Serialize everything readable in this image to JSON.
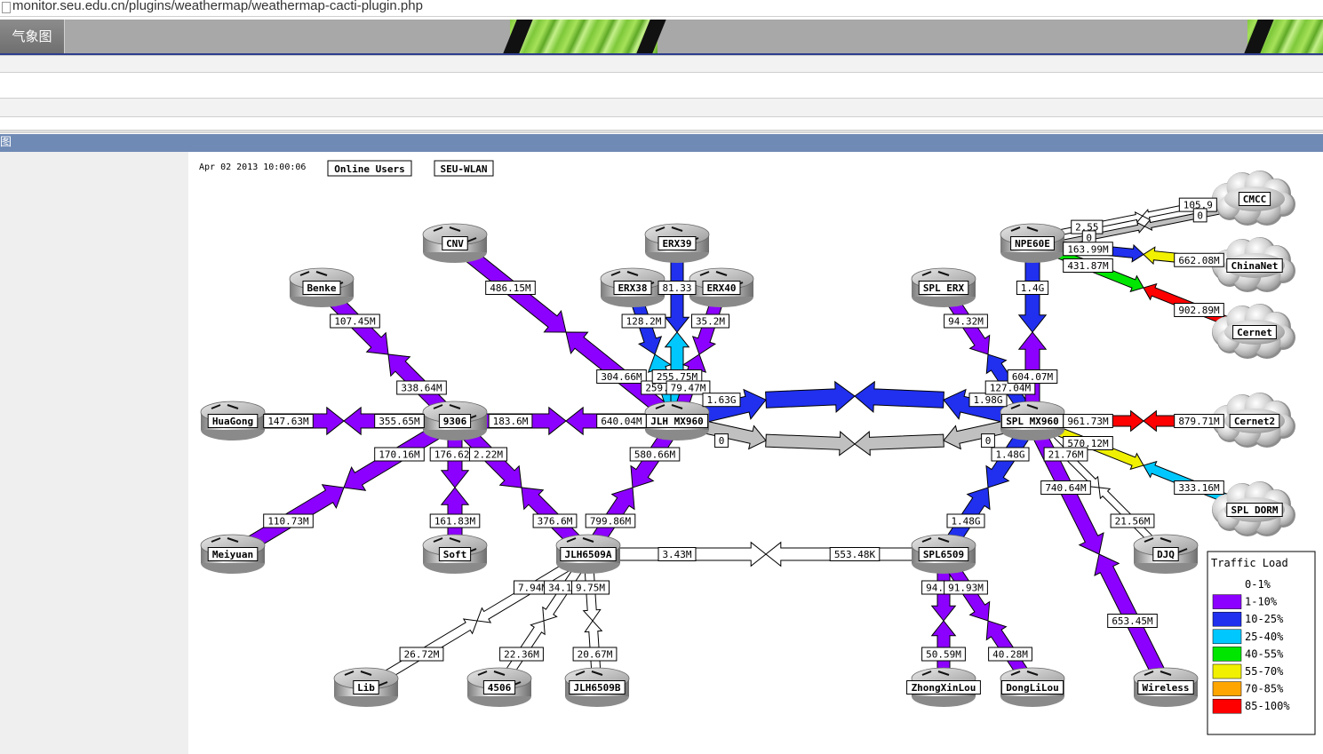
{
  "browser": {
    "url": "monitor.seu.edu.cn/plugins/weathermap/weathermap-cacti-plugin.php"
  },
  "header": {
    "tab_label": "气象图"
  },
  "section": {
    "label": "图"
  },
  "map": {
    "timestamp": "Apr 02 2013 10:00:06",
    "buttons": [
      "Online Users",
      "SEU-WLAN"
    ],
    "colors": {
      "gray": "#c0c0c0",
      "white": "#ffffff",
      "purple": "#8c00ff",
      "blue": "#2030ee",
      "cyan": "#00c8ff",
      "green": "#00e600",
      "yellow": "#f0f000",
      "orange": "#ffa500",
      "red": "#ff0000"
    },
    "nodes": [
      {
        "id": "cnv",
        "label": "CNV",
        "type": "router"
      },
      {
        "id": "erx39",
        "label": "ERX39",
        "type": "router"
      },
      {
        "id": "erx38",
        "label": "ERX38",
        "type": "router"
      },
      {
        "id": "erx40",
        "label": "ERX40",
        "type": "router"
      },
      {
        "id": "benke",
        "label": "Benke",
        "type": "router"
      },
      {
        "id": "huagong",
        "label": "HuaGong",
        "type": "router"
      },
      {
        "id": "n9306",
        "label": "9306",
        "type": "router"
      },
      {
        "id": "jlhmx",
        "label": "JLH MX960",
        "type": "router"
      },
      {
        "id": "meiyuan",
        "label": "Meiyuan",
        "type": "router"
      },
      {
        "id": "soft",
        "label": "Soft",
        "type": "router"
      },
      {
        "id": "jlh6509a",
        "label": "JLH6509A",
        "type": "router"
      },
      {
        "id": "lib",
        "label": "Lib",
        "type": "router"
      },
      {
        "id": "n4506",
        "label": "4506",
        "type": "router"
      },
      {
        "id": "jlh6509b",
        "label": "JLH6509B",
        "type": "router"
      },
      {
        "id": "splerx",
        "label": "SPL ERX",
        "type": "router"
      },
      {
        "id": "npe60e",
        "label": "NPE60E",
        "type": "router"
      },
      {
        "id": "splmx",
        "label": "SPL MX960",
        "type": "router"
      },
      {
        "id": "spl6509",
        "label": "SPL6509",
        "type": "router"
      },
      {
        "id": "zhongxinlou",
        "label": "ZhongXinLou",
        "type": "router"
      },
      {
        "id": "donglilou",
        "label": "DongLiLou",
        "type": "router"
      },
      {
        "id": "djq",
        "label": "DJQ",
        "type": "router"
      },
      {
        "id": "wireless",
        "label": "Wireless",
        "type": "router"
      },
      {
        "id": "cmcc",
        "label": "CMCC",
        "type": "cloud"
      },
      {
        "id": "chinanet",
        "label": "ChinaNet",
        "type": "cloud"
      },
      {
        "id": "cernet",
        "label": "Cernet",
        "type": "cloud"
      },
      {
        "id": "cernet2",
        "label": "Cernet2",
        "type": "cloud"
      },
      {
        "id": "spldorm",
        "label": "SPL DORM",
        "type": "cloud"
      }
    ],
    "links": [
      {
        "from": "benke",
        "to": "n9306",
        "w": 16,
        "a": {
          "label": "107.45M",
          "color": "purple"
        },
        "b": {
          "label": "338.64M",
          "color": "purple"
        }
      },
      {
        "from": "cnv",
        "to": "jlhmx",
        "w": 16,
        "a": {
          "label": "486.15M",
          "color": "purple"
        },
        "b": {
          "label": "304.66M",
          "color": "purple"
        }
      },
      {
        "from": "erx38",
        "to": "jlhmx",
        "w": 14,
        "a": {
          "label": "128.2M",
          "color": "blue"
        },
        "b": {
          "label": "259.44M",
          "color": "cyan"
        }
      },
      {
        "from": "erx39",
        "to": "jlhmx",
        "w": 14,
        "a": {
          "label": "81.33",
          "color": "blue"
        },
        "b": {
          "label": "255.75M",
          "color": "cyan"
        }
      },
      {
        "from": "erx40",
        "to": "jlhmx",
        "w": 14,
        "a": {
          "label": "35.2M",
          "color": "purple"
        },
        "b": {
          "label": "79.47M",
          "color": "purple"
        }
      },
      {
        "from": "huagong",
        "to": "n9306",
        "w": 16,
        "a": {
          "label": "147.63M",
          "color": "purple"
        },
        "b": {
          "label": "355.65M",
          "color": "purple"
        }
      },
      {
        "from": "n9306",
        "to": "jlhmx",
        "w": 16,
        "a": {
          "label": "183.6M",
          "color": "purple"
        },
        "b": {
          "label": "640.04M",
          "color": "purple"
        }
      },
      {
        "from": "n9306",
        "to": "meiyuan",
        "w": 16,
        "a": {
          "label": "170.16M",
          "color": "purple"
        },
        "b": {
          "label": "110.73M",
          "color": "purple"
        }
      },
      {
        "from": "n9306",
        "to": "soft",
        "w": 16,
        "a": {
          "label": "176.62M",
          "color": "purple"
        },
        "b": {
          "label": "161.83M",
          "color": "purple"
        }
      },
      {
        "from": "n9306",
        "to": "jlh6509a",
        "w": 16,
        "a": {
          "label": "2.22M",
          "color": "purple"
        },
        "b": {
          "label": "376.6M",
          "color": "purple"
        }
      },
      {
        "from": "jlhmx",
        "to": "jlh6509a",
        "w": 16,
        "a": {
          "label": "580.66M",
          "color": "purple"
        },
        "b": {
          "label": "799.86M",
          "color": "purple"
        }
      },
      {
        "from": "jlhmx",
        "to": "splmx",
        "w": 18,
        "a": {
          "label": "1.63G",
          "color": "blue"
        },
        "b": {
          "label": "1.98G",
          "color": "blue"
        },
        "curve": -28
      },
      {
        "from": "jlhmx",
        "to": "splmx",
        "w": 14,
        "a": {
          "label": "0",
          "color": "gray"
        },
        "b": {
          "label": "0",
          "color": "gray"
        },
        "curve": 26
      },
      {
        "from": "jlh6509a",
        "to": "spl6509",
        "w": 14,
        "a": {
          "label": "3.43M",
          "color": "white"
        },
        "b": {
          "label": "553.48K",
          "color": "white"
        }
      },
      {
        "from": "jlh6509a",
        "to": "lib",
        "w": 10,
        "a": {
          "label": "7.94M",
          "color": "white"
        },
        "b": {
          "label": "26.72M",
          "color": "white"
        }
      },
      {
        "from": "jlh6509a",
        "to": "n4506",
        "w": 10,
        "a": {
          "label": "34.19M",
          "color": "white"
        },
        "b": {
          "label": "22.36M",
          "color": "white"
        }
      },
      {
        "from": "jlh6509a",
        "to": "jlh6509b",
        "w": 10,
        "a": {
          "label": "9.75M",
          "color": "white"
        },
        "b": {
          "label": "20.67M",
          "color": "white"
        }
      },
      {
        "from": "splerx",
        "to": "splmx",
        "w": 14,
        "a": {
          "label": "94.32M",
          "color": "purple"
        },
        "b": {
          "label": "127.04M",
          "color": "blue"
        }
      },
      {
        "from": "npe60e",
        "to": "splmx",
        "w": 16,
        "a": {
          "label": "1.4G",
          "color": "blue"
        },
        "b": {
          "label": "604.07M",
          "color": "purple"
        }
      },
      {
        "from": "npe60e",
        "to": "cmcc",
        "w": 6,
        "a": {
          "label": "2.55",
          "color": "white"
        },
        "b": {
          "label": "105.9",
          "color": "white"
        },
        "offset": -6
      },
      {
        "from": "npe60e",
        "to": "cmcc",
        "w": 6,
        "a": {
          "label": "0",
          "color": "gray"
        },
        "b": {
          "label": "0",
          "color": "gray"
        },
        "offset": 6
      },
      {
        "from": "npe60e",
        "to": "chinanet",
        "w": 10,
        "a": {
          "label": "163.99M",
          "color": "blue"
        },
        "b": {
          "label": "662.08M",
          "color": "yellow"
        }
      },
      {
        "from": "npe60e",
        "to": "cernet",
        "w": 10,
        "a": {
          "label": "431.87M",
          "color": "green"
        },
        "b": {
          "label": "902.89M",
          "color": "red"
        }
      },
      {
        "from": "splmx",
        "to": "cernet2",
        "w": 12,
        "a": {
          "label": "961.73M",
          "color": "red"
        },
        "b": {
          "label": "879.71M",
          "color": "red"
        }
      },
      {
        "from": "splmx",
        "to": "spldorm",
        "w": 10,
        "a": {
          "label": "570.12M",
          "color": "yellow"
        },
        "b": {
          "label": "333.16M",
          "color": "cyan"
        }
      },
      {
        "from": "splmx",
        "to": "djq",
        "w": 8,
        "a": {
          "label": "21.76M",
          "color": "white"
        },
        "b": {
          "label": "21.56M",
          "color": "white"
        }
      },
      {
        "from": "splmx",
        "to": "wireless",
        "w": 16,
        "a": {
          "label": "740.64M",
          "color": "purple"
        },
        "b": {
          "label": "653.45M",
          "color": "purple"
        }
      },
      {
        "from": "splmx",
        "to": "spl6509",
        "w": 16,
        "a": {
          "label": "1.48G",
          "color": "blue"
        },
        "b": {
          "label": "1.48G",
          "color": "blue"
        }
      },
      {
        "from": "spl6509",
        "to": "zhongxinlou",
        "w": 14,
        "a": {
          "label": "94.35M",
          "color": "purple"
        },
        "b": {
          "label": "50.59M",
          "color": "purple"
        }
      },
      {
        "from": "spl6509",
        "to": "donglilou",
        "w": 14,
        "a": {
          "label": "91.93M",
          "color": "purple"
        },
        "b": {
          "label": "40.28M",
          "color": "purple"
        }
      }
    ],
    "legend": {
      "title": "Traffic Load",
      "items": [
        {
          "label": "0-1%",
          "color": "#ffffff"
        },
        {
          "label": "1-10%",
          "color": "#8c00ff"
        },
        {
          "label": "10-25%",
          "color": "#2030ee"
        },
        {
          "label": "25-40%",
          "color": "#00c8ff"
        },
        {
          "label": "40-55%",
          "color": "#00e600"
        },
        {
          "label": "55-70%",
          "color": "#f0f000"
        },
        {
          "label": "70-85%",
          "color": "#ffa500"
        },
        {
          "label": "85-100%",
          "color": "#ff0000"
        }
      ]
    }
  }
}
